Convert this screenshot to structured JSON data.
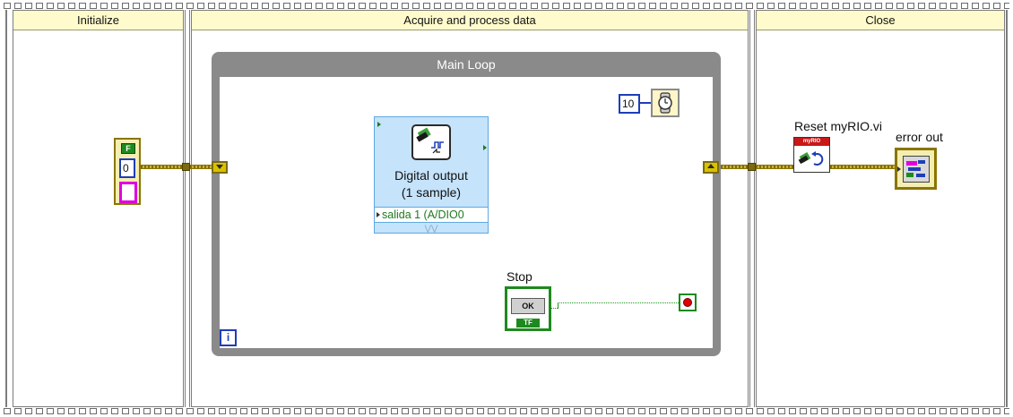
{
  "sequence": {
    "frames": [
      {
        "label": "Initialize"
      },
      {
        "label": "Acquire and process data"
      },
      {
        "label": "Close"
      }
    ]
  },
  "error_cluster_constant": {
    "status": "F",
    "code": "0",
    "source": ""
  },
  "while_loop": {
    "label": "Main Loop",
    "iteration_terminal": "i"
  },
  "digital_output": {
    "title_line1": "Digital output",
    "title_line2": "(1 sample)",
    "channel": "salida 1 (A/DIO0"
  },
  "wait": {
    "ms_value": "10"
  },
  "stop": {
    "label": "Stop",
    "button_text": "OK",
    "type_text": "TF"
  },
  "reset": {
    "label": "Reset myRIO.vi",
    "banner": "myRIO"
  },
  "error_out": {
    "label": "error out"
  },
  "colors": {
    "frame_header": "#fffbcc",
    "loop_border": "#8a8a8a",
    "cluster_wire": "#8a7400",
    "boolean_wire": "#1c9a1c",
    "numeric_blue": "#1e3eb8",
    "string_pink": "#e000e0",
    "express_vi_bg": "#c5e3fb"
  }
}
